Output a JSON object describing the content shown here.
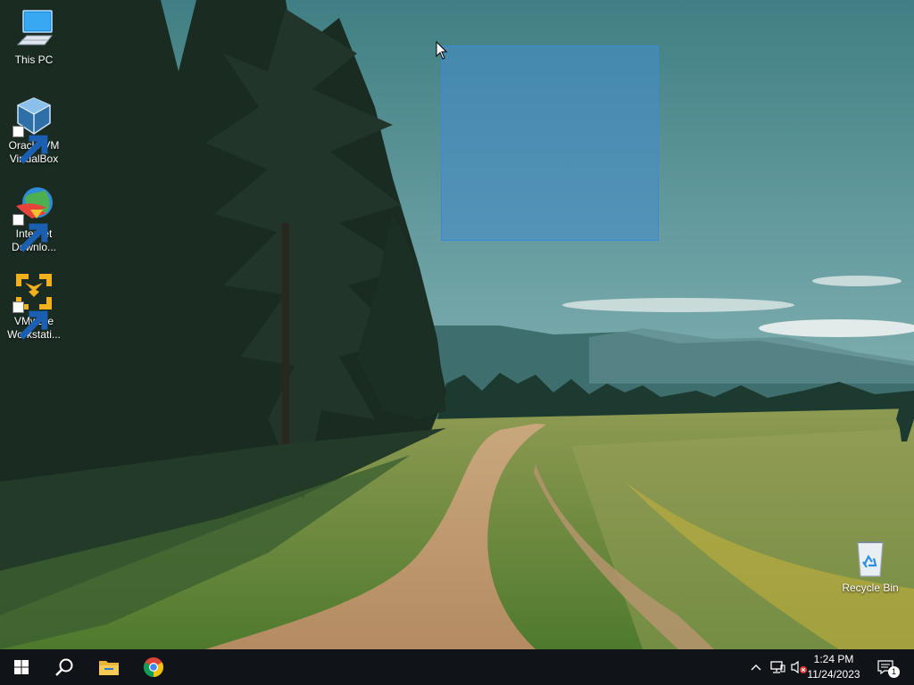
{
  "desktop": {
    "icons": [
      {
        "name": "this-pc",
        "label": "This PC",
        "icon": "computer-icon"
      },
      {
        "name": "oracle-vm-virtualbox",
        "label": "Oracle VM\nVirtualBox",
        "icon": "virtualbox-icon",
        "shortcut": true
      },
      {
        "name": "internet-download-manager",
        "label": "Internet\nDownlo...",
        "icon": "idm-globe-icon",
        "shortcut": true
      },
      {
        "name": "vmware-workstation",
        "label": "VMware\nWorkstati...",
        "icon": "vmware-icon",
        "shortcut": true
      },
      {
        "name": "recycle-bin",
        "label": "Recycle Bin",
        "icon": "recycle-bin-icon"
      }
    ],
    "selection": {
      "color": "#468ccd",
      "border": "#3c8ad7"
    }
  },
  "taskbar": {
    "background": "#101418",
    "pinned": [
      {
        "name": "start",
        "icon": "windows-logo-icon"
      },
      {
        "name": "search",
        "icon": "search-icon"
      },
      {
        "name": "file-explorer",
        "icon": "folder-icon"
      },
      {
        "name": "chrome",
        "icon": "chrome-icon"
      }
    ],
    "tray": {
      "icons": [
        "chevron-up-icon",
        "network-icon",
        "volume-muted-icon"
      ],
      "time": "1:24 PM",
      "date": "11/24/2023",
      "notification_count": "1"
    }
  }
}
